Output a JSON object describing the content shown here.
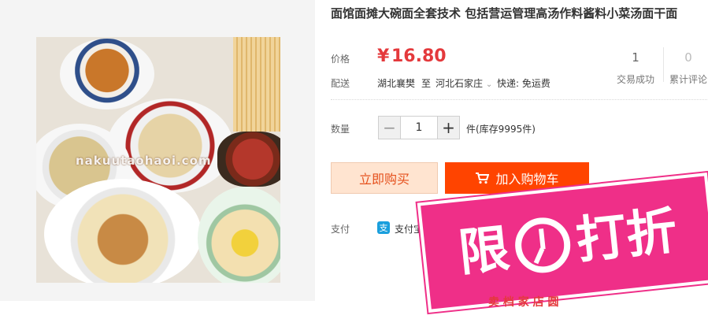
{
  "product": {
    "title": "面馆面摊大碗面全套技术 包括营运管理高汤作料酱料小菜汤面干面",
    "watermark": "nakuutaohaoi.com"
  },
  "price": {
    "label": "价格",
    "currency": "¥",
    "value": "16.80"
  },
  "stats": {
    "transactions_count": "1",
    "transactions_label": "交易成功",
    "reviews_count": "0",
    "reviews_label": "累计评论"
  },
  "shipping": {
    "label": "配送",
    "from": "湖北襄樊",
    "to_word": "至",
    "destination": "河北石家庄",
    "express": "快递: 免运费"
  },
  "quantity": {
    "label": "数量",
    "value": "1",
    "minus": "−",
    "plus": "+",
    "stock": "件(库存9995件)"
  },
  "buttons": {
    "buy_now": "立即购买",
    "add_to_cart": "加入购物车"
  },
  "payment": {
    "label": "支付",
    "icon_char": "支",
    "method": "支付宝"
  },
  "promo": {
    "left": "限",
    "right": "打折",
    "strip": "卖 档 家 店 圆"
  },
  "icons": {
    "cart": "cart-icon",
    "clock": "clock-icon",
    "chevron": "chevron-down-icon"
  },
  "colors": {
    "price": "#e4393c",
    "cart_button": "#ff4400",
    "buy_button_bg": "#ffe4d0",
    "promo_badge": "#ef2f88"
  }
}
